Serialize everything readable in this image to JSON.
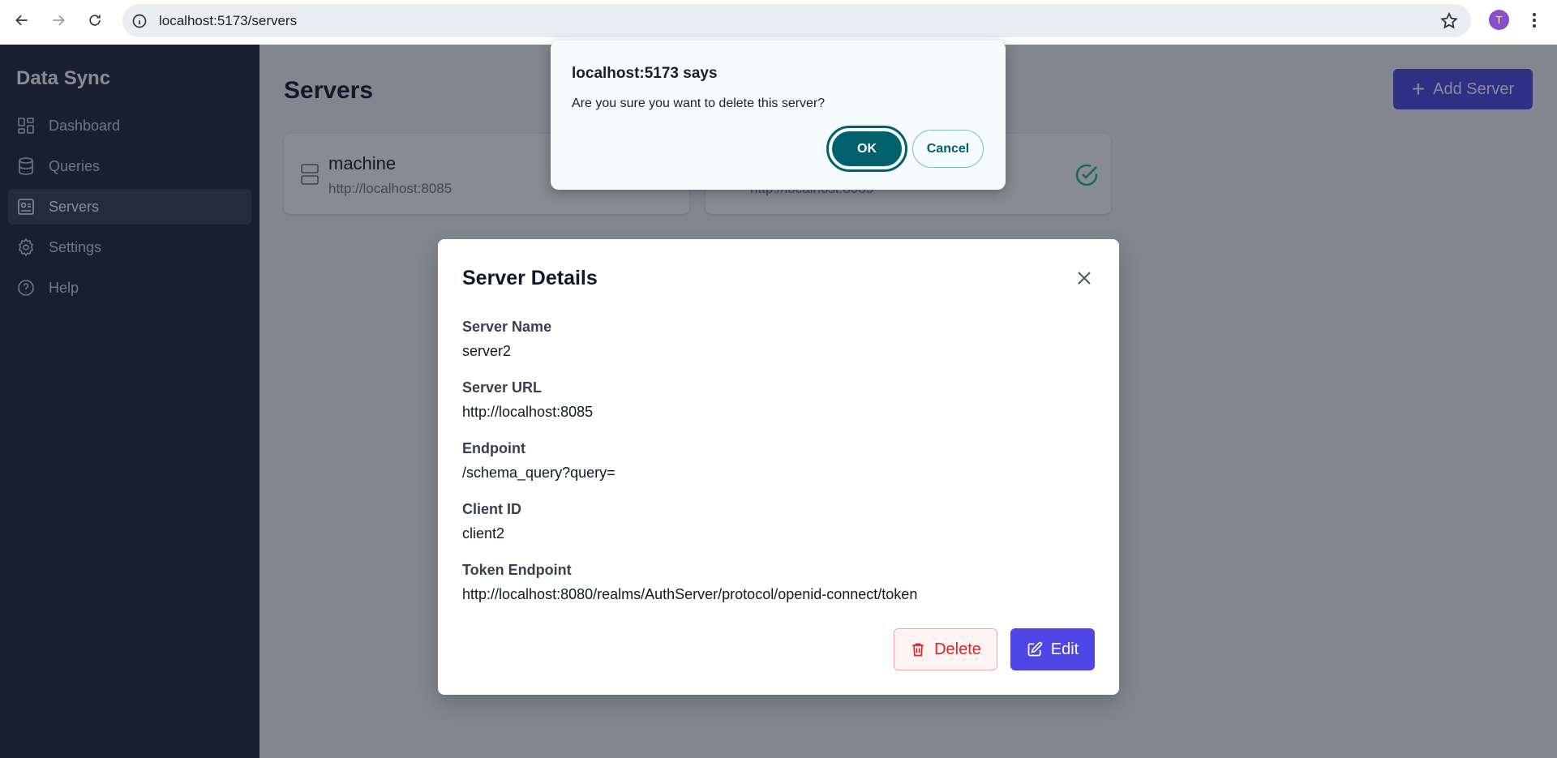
{
  "browser": {
    "url": "localhost:5173/servers",
    "profile_initial": "T"
  },
  "sidebar": {
    "brand": "Data Sync",
    "items": [
      {
        "label": "Dashboard",
        "icon": "dashboard-icon",
        "active": false
      },
      {
        "label": "Queries",
        "icon": "database-icon",
        "active": false
      },
      {
        "label": "Servers",
        "icon": "server-icon",
        "active": true
      },
      {
        "label": "Settings",
        "icon": "gear-icon",
        "active": false
      },
      {
        "label": "Help",
        "icon": "help-icon",
        "active": false
      }
    ]
  },
  "main": {
    "title": "Servers",
    "add_button_label": "Add Server",
    "cards": [
      {
        "name": "machine",
        "url": "http://localhost:8085"
      },
      {
        "name": "",
        "url": "http://localhost:8085",
        "status": "connected"
      }
    ]
  },
  "modal": {
    "title": "Server Details",
    "fields": [
      {
        "label": "Server Name",
        "value": "server2"
      },
      {
        "label": "Server URL",
        "value": "http://localhost:8085"
      },
      {
        "label": "Endpoint",
        "value": "/schema_query?query="
      },
      {
        "label": "Client ID",
        "value": "client2"
      },
      {
        "label": "Token Endpoint",
        "value": "http://localhost:8080/realms/AuthServer/protocol/openid-connect/token"
      }
    ],
    "delete_label": "Delete",
    "edit_label": "Edit"
  },
  "alert": {
    "title": "localhost:5173 says",
    "message": "Are you sure you want to delete this server?",
    "ok_label": "OK",
    "cancel_label": "Cancel"
  },
  "colors": {
    "accent": "#4f46e5",
    "sidebar_bg": "#1f2937",
    "danger": "#dc2626",
    "alert_button": "#00606c",
    "success": "#10b981"
  }
}
